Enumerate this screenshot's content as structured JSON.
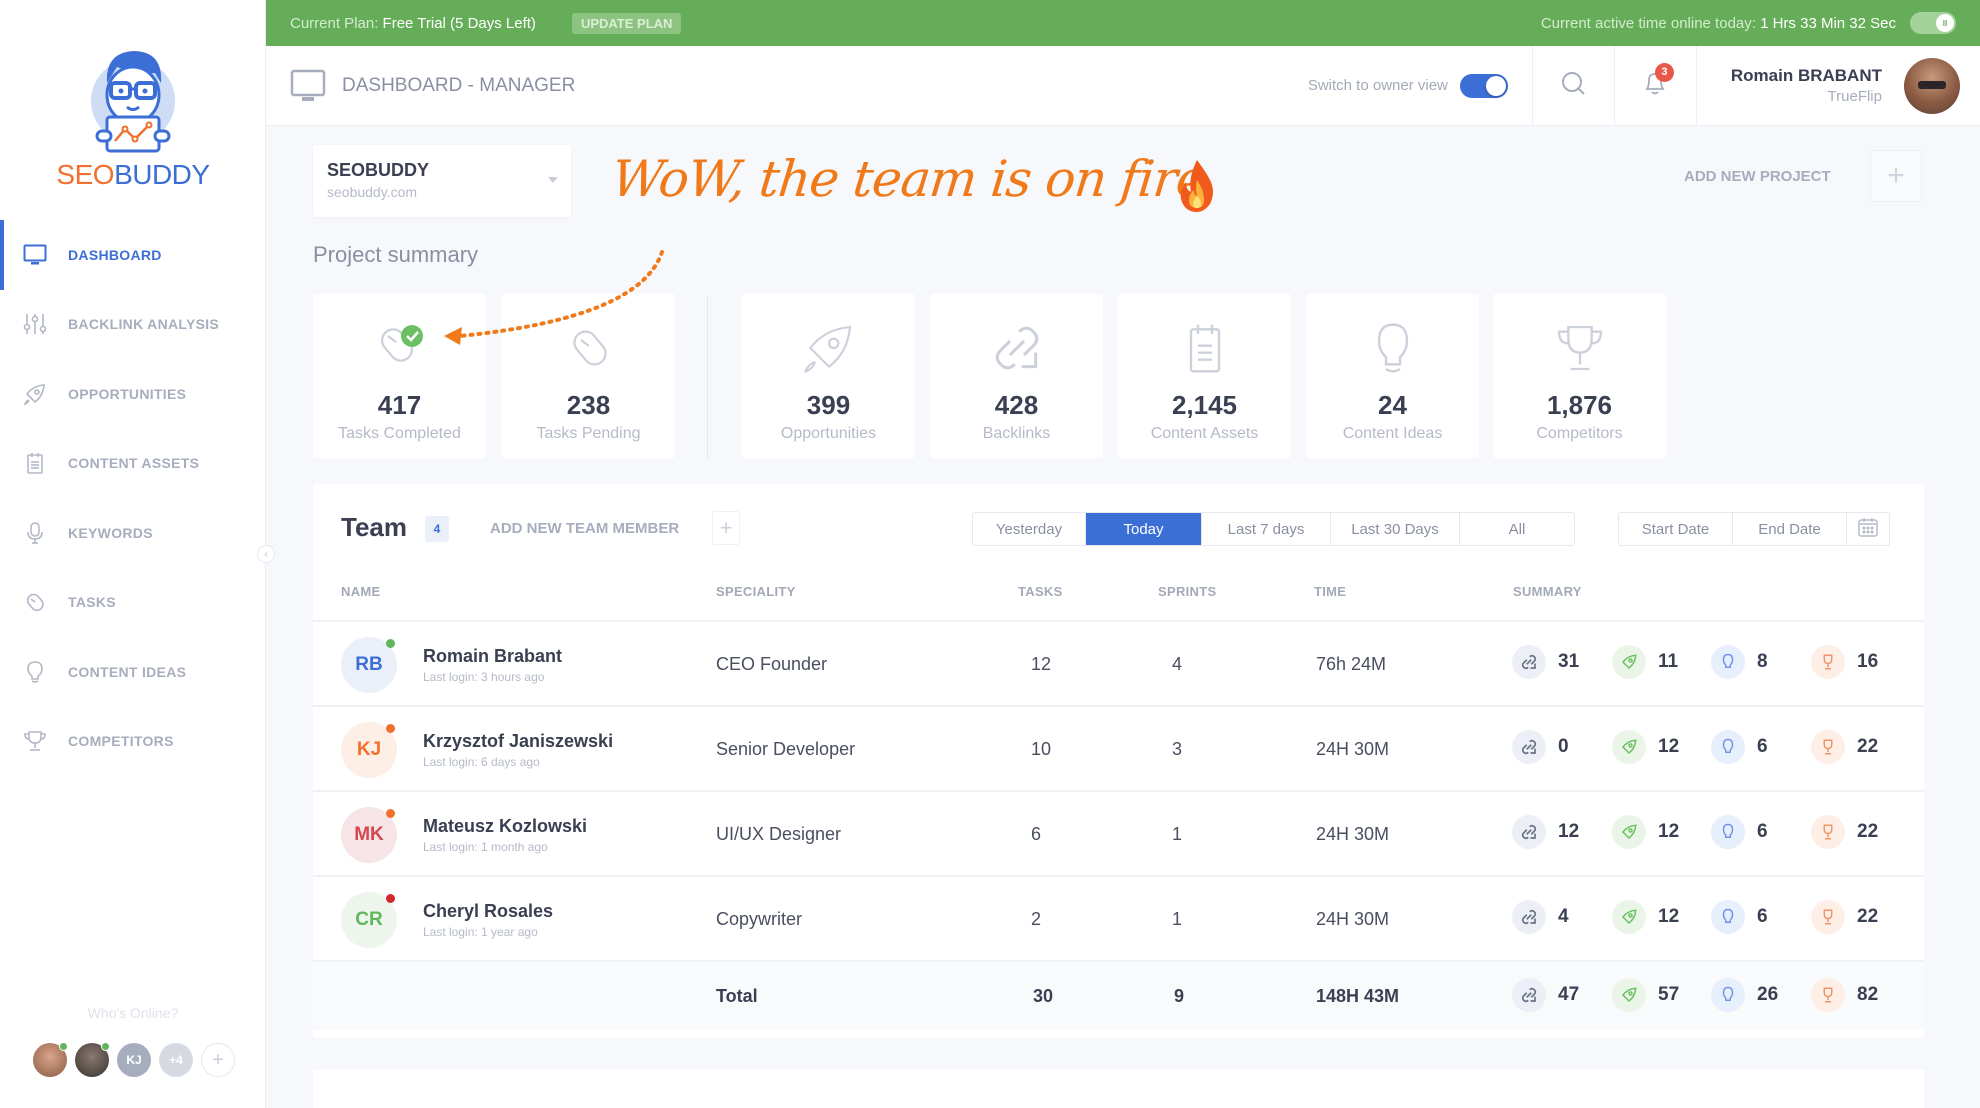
{
  "topbar": {
    "plan_label": "Current Plan:",
    "plan_value": "Free Trial (5 Days Left)",
    "update_button": "UPDATE PLAN",
    "active_label": "Current active time online today:",
    "active_value": "1 Hrs 33 Min 32 Sec"
  },
  "brand": {
    "part1": "SEO",
    "part2": "BUDDY",
    "colors": {
      "orange": "#f0702f",
      "blue": "#3c6fd6"
    }
  },
  "sidebar": {
    "items": [
      {
        "label": "DASHBOARD",
        "icon": "monitor-icon",
        "active": true
      },
      {
        "label": "BACKLINK ANALYSIS",
        "icon": "sliders-icon",
        "active": false
      },
      {
        "label": "OPPORTUNITIES",
        "icon": "rocket-icon",
        "active": false
      },
      {
        "label": "CONTENT ASSETS",
        "icon": "clipboard-icon",
        "active": false
      },
      {
        "label": "KEYWORDS",
        "icon": "microphone-icon",
        "active": false
      },
      {
        "label": "TASKS",
        "icon": "mouse-icon",
        "active": false
      },
      {
        "label": "CONTENT IDEAS",
        "icon": "lightbulb-icon",
        "active": false
      },
      {
        "label": "COMPETITORS",
        "icon": "trophy-icon",
        "active": false
      }
    ],
    "whos_online_label": "Who's Online?",
    "online_users": [
      {
        "type": "photo",
        "online": true
      },
      {
        "type": "photo",
        "online": true
      },
      {
        "initials": "KJ",
        "online": false
      },
      {
        "initials": "+4"
      },
      {
        "initials": "+"
      }
    ]
  },
  "header": {
    "title": "DASHBOARD - MANAGER",
    "owner_switch_label": "Switch to owner view",
    "owner_switch_on": true,
    "notification_count": "3",
    "user_name": "Romain BRABANT",
    "user_company": "TrueFlip"
  },
  "project": {
    "name": "SEOBUDDY",
    "url": "seobuddy.com",
    "add_label": "ADD NEW PROJECT",
    "add_icon": "+"
  },
  "annotation": {
    "text": "WoW, the team is on fire",
    "emoji": "fire-icon",
    "color": "#f07a1a"
  },
  "summary": {
    "title": "Project summary",
    "stats": [
      {
        "value": "417",
        "label": "Tasks Completed",
        "icon": "mouse-check-icon"
      },
      {
        "value": "238",
        "label": "Tasks Pending",
        "icon": "mouse-icon"
      },
      {
        "value": "399",
        "label": "Opportunities",
        "icon": "rocket-icon"
      },
      {
        "value": "428",
        "label": "Backlinks",
        "icon": "link-icon"
      },
      {
        "value": "2,145",
        "label": "Content Assets",
        "icon": "clipboard-icon"
      },
      {
        "value": "24",
        "label": "Content Ideas",
        "icon": "lightbulb-icon"
      },
      {
        "value": "1,876",
        "label": "Competitors",
        "icon": "trophy-icon"
      }
    ]
  },
  "team": {
    "title": "Team",
    "count": "4",
    "add_label": "ADD NEW TEAM MEMBER",
    "add_icon": "+",
    "ranges": [
      {
        "label": "Yesterday",
        "active": false
      },
      {
        "label": "Today",
        "active": true
      },
      {
        "label": "Last 7 days",
        "active": false
      },
      {
        "label": "Last 30 Days",
        "active": false
      },
      {
        "label": "All",
        "active": false
      }
    ],
    "start_date_placeholder": "Start Date",
    "end_date_placeholder": "End Date",
    "columns": [
      "NAME",
      "SPECIALITY",
      "TASKS",
      "SPRINTS",
      "TIME",
      "SUMMARY"
    ],
    "members": [
      {
        "initials": "RB",
        "name": "Romain Brabant",
        "last_login": "Last login: 3 hours ago",
        "speciality": "CEO Founder",
        "tasks": "12",
        "sprints": "4",
        "time": "76h 24M",
        "status": "#5fb75a",
        "avatar_bg": "#eaeffa",
        "avatar_fg": "#3c6fd6",
        "summary": [
          "31",
          "11",
          "8",
          "16"
        ]
      },
      {
        "initials": "KJ",
        "name": "Krzysztof Janiszewski",
        "last_login": "Last login: 6 days ago",
        "speciality": "Senior Developer",
        "tasks": "10",
        "sprints": "3",
        "time": "24H 30M",
        "status": "#f0702f",
        "avatar_bg": "#fdeee6",
        "avatar_fg": "#f0702f",
        "summary": [
          "0",
          "12",
          "6",
          "22"
        ]
      },
      {
        "initials": "MK",
        "name": "Mateusz Kozlowski",
        "last_login": "Last login: 1 month ago",
        "speciality": "UI/UX Designer",
        "tasks": "6",
        "sprints": "1",
        "time": "24H 30M",
        "status": "#f0702f",
        "avatar_bg": "#f6e4e6",
        "avatar_fg": "#d4474f",
        "summary": [
          "12",
          "12",
          "6",
          "22"
        ]
      },
      {
        "initials": "CR",
        "name": "Cheryl Rosales",
        "last_login": "Last login: 1 year ago",
        "speciality": "Copywriter",
        "tasks": "2",
        "sprints": "1",
        "time": "24H 30M",
        "status": "#d4272f",
        "avatar_bg": "#eef5ec",
        "avatar_fg": "#5fb75a",
        "summary": [
          "4",
          "12",
          "6",
          "22"
        ]
      }
    ],
    "total": {
      "label": "Total",
      "tasks": "30",
      "sprints": "9",
      "time": "148H 43M",
      "summary": [
        "47",
        "57",
        "26",
        "82"
      ]
    },
    "summary_icons": [
      {
        "name": "backlink-icon",
        "bg": "#eceff5",
        "fg": "#6b7185"
      },
      {
        "name": "rocket-icon",
        "bg": "#eaf5e8",
        "fg": "#6cc163"
      },
      {
        "name": "lightbulb-icon",
        "bg": "#e8effc",
        "fg": "#6f96e6"
      },
      {
        "name": "trophy-icon",
        "bg": "#fdeee6",
        "fg": "#f0956a"
      }
    ]
  }
}
